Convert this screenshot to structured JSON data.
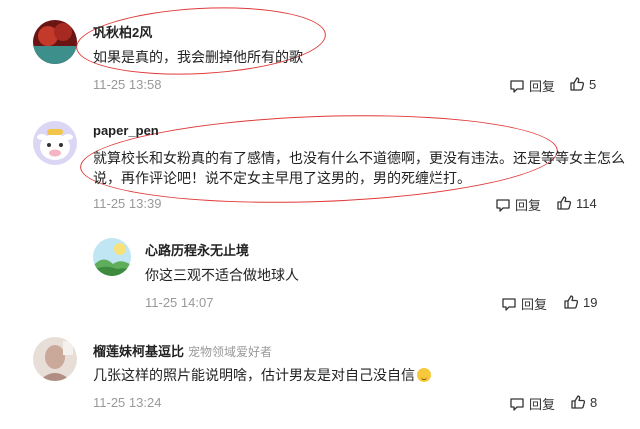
{
  "comments": [
    {
      "username": "巩秋柏2风",
      "text": "如果是真的，我会删掉他所有的歌",
      "time": "11-25 13:58",
      "reply_label": "回复",
      "likes": "5"
    },
    {
      "username": "paper_pen",
      "text_line1": "就算校长和女粉真的有了感情，也没有什么不道德啊，更没有违法。还是等等女主怎么",
      "text_line2": "说，再作评论吧！说不定女主早甩了这男的，男的死缠烂打。",
      "time": "11-25 13:39",
      "reply_label": "回复",
      "likes": "114"
    },
    {
      "username": "心路历程永无止境",
      "text": "你这三观不适合做地球人",
      "time": "11-25 14:07",
      "reply_label": "回复",
      "likes": "19"
    },
    {
      "username": "榴莲妹柯基逗比",
      "tag": "宠物领域爱好者",
      "text": "几张这样的照片能说明啥，估计男友是对自己没自信",
      "time": "11-25 13:24",
      "reply_label": "回复",
      "likes": "8"
    }
  ],
  "colors": {
    "annotation": "#e03a3a",
    "muted": "#999999"
  }
}
